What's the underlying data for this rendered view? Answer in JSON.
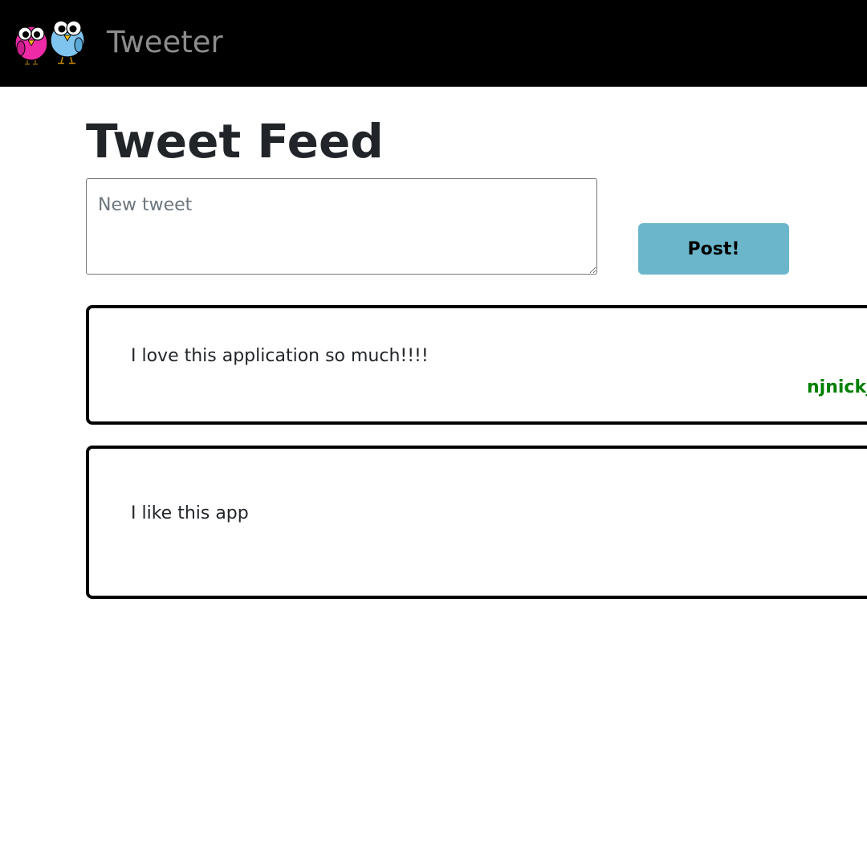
{
  "navbar": {
    "logo_icon": "two-birds-logo-icon",
    "brand": "Tweeter",
    "background": "#000000",
    "brand_color": "#8c8c8c"
  },
  "main": {
    "title": "Tweet Feed",
    "new_tweet": {
      "value": "",
      "placeholder": "New tweet"
    },
    "post_button_label": "Post!",
    "post_button_color": "#6bb6cb"
  },
  "tweets": [
    {
      "text": "I love this application so much!!!!",
      "author": "njnickj"
    },
    {
      "text": "I like this app"
    }
  ],
  "colors": {
    "author": "#008000"
  }
}
